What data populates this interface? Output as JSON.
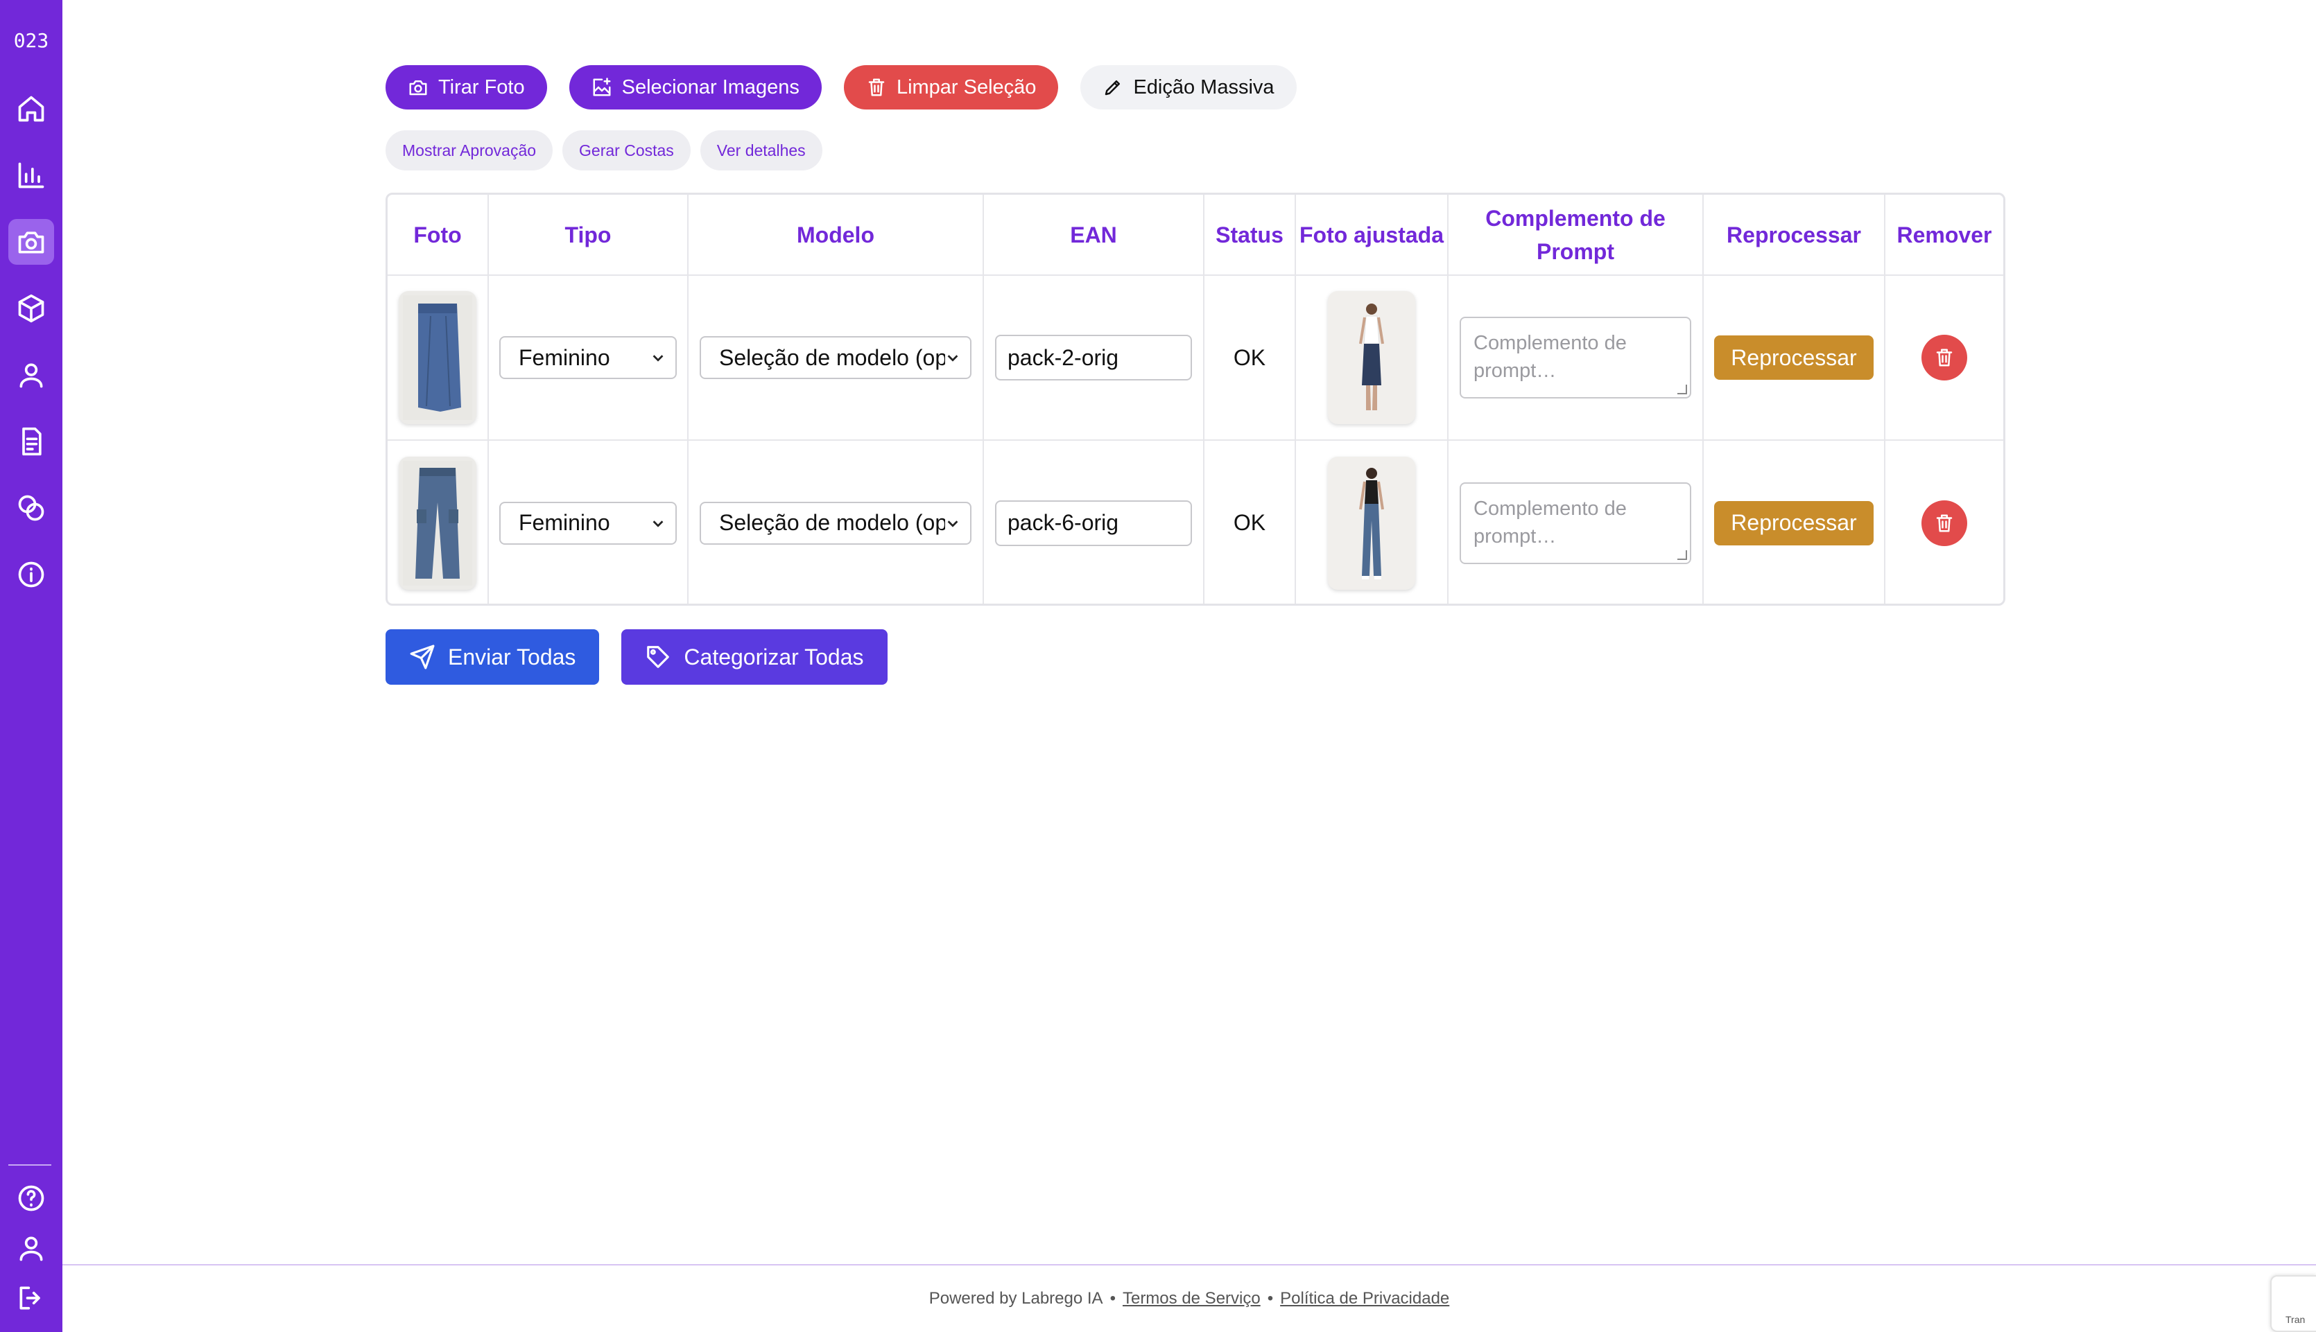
{
  "sidebar": {
    "brand": "023",
    "items": [
      {
        "icon": "home-icon"
      },
      {
        "icon": "bar-chart-icon"
      },
      {
        "icon": "camera-icon",
        "active": true
      },
      {
        "icon": "box-icon"
      },
      {
        "icon": "user-icon"
      },
      {
        "icon": "document-icon"
      },
      {
        "icon": "coins-icon"
      },
      {
        "icon": "info-icon"
      }
    ],
    "bottom": [
      {
        "icon": "help-icon"
      },
      {
        "icon": "profile-icon"
      },
      {
        "icon": "logout-icon"
      }
    ]
  },
  "toolbar": {
    "take_photo": "Tirar Foto",
    "select_images": "Selecionar Imagens",
    "clear_selection": "Limpar Seleção",
    "bulk_edit": "Edição Massiva"
  },
  "subbar": {
    "show_approval": "Mostrar Aprovação",
    "generate_backs": "Gerar Costas",
    "view_details": "Ver detalhes"
  },
  "table": {
    "headers": {
      "photo": "Foto",
      "type": "Tipo",
      "model": "Modelo",
      "ean": "EAN",
      "status": "Status",
      "adjusted_photo": "Foto ajustada",
      "prompt_complement": "Complemento de Prompt",
      "reprocess": "Reprocessar",
      "remove": "Remover"
    },
    "rows": [
      {
        "garment": "skirt",
        "type": "Feminino",
        "model": "Seleção de modelo (op",
        "ean": "pack-2-orig",
        "status": "OK",
        "prompt_placeholder": "Complemento de prompt…",
        "reprocess_label": "Reprocessar"
      },
      {
        "garment": "pants",
        "type": "Feminino",
        "model": "Seleção de modelo (op",
        "ean": "pack-6-orig",
        "status": "OK",
        "prompt_placeholder": "Complemento de prompt…",
        "reprocess_label": "Reprocessar"
      }
    ]
  },
  "actions": {
    "send_all": "Enviar Todas",
    "categorize_all": "Categorizar Todas"
  },
  "footer": {
    "powered": "Powered by Labrego IA",
    "bullet": "•",
    "terms": "Termos de Serviço",
    "privacy": "Política de Privacidade"
  },
  "recaptcha_text": "Tran",
  "colors": {
    "brand": "#7228d9",
    "danger": "#e24b4b",
    "reprocess": "#c98d2b",
    "send": "#2f5be0",
    "categorize": "#5a3ae0"
  }
}
